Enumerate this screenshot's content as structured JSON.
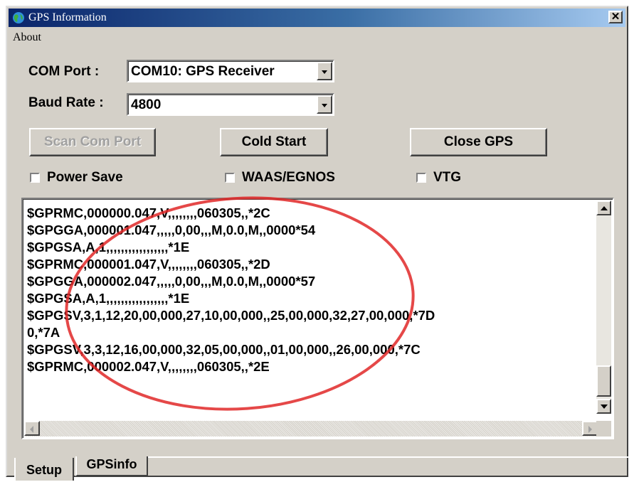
{
  "window": {
    "title": "GPS Information",
    "close_glyph": "✕"
  },
  "menu": {
    "about": "About"
  },
  "com_port": {
    "label": "COM Port :",
    "value": "COM10:  GPS Receiver"
  },
  "baud_rate": {
    "label": "Baud Rate :",
    "value": "4800"
  },
  "buttons": {
    "scan": "Scan Com Port",
    "cold_start": "Cold Start",
    "close_gps": "Close GPS"
  },
  "checkboxes": {
    "power_save": "Power Save",
    "waas": "WAAS/EGNOS",
    "vtg": "VTG"
  },
  "log": {
    "lines": [
      "$GPRMC,000000.047,V,,,,,,,,060305,,*2C",
      "$GPGGA,000001.047,,,,,0,00,,,M,0.0,M,,0000*54",
      "$GPGSA,A,1,,,,,,,,,,,,,,,,,*1E",
      "$GPRMC,000001.047,V,,,,,,,,060305,,*2D",
      "$GPGGA,000002.047,,,,,0,00,,,M,0.0,M,,0000*57",
      "$GPGSA,A,1,,,,,,,,,,,,,,,,,*1E",
      "$GPGSV,3,1,12,20,00,000,27,10,00,000,,25,00,000,32,27,00,000,*7D",
      "0,*7A",
      "$GPGSV,3,3,12,16,00,000,32,05,00,000,,01,00,000,,26,00,000,*7C",
      "$GPRMC,000002.047,V,,,,,,,,060305,,*2E"
    ]
  },
  "tabs": {
    "setup": "Setup",
    "gpsinfo": "GPSinfo"
  },
  "colors": {
    "titlebar_start": "#0a246a",
    "titlebar_end": "#a6caf0",
    "annotation_ellipse": "#e02828",
    "window_bg": "#d4d0c8"
  },
  "icons": {
    "app": "globe-icon",
    "close": "close-icon"
  }
}
